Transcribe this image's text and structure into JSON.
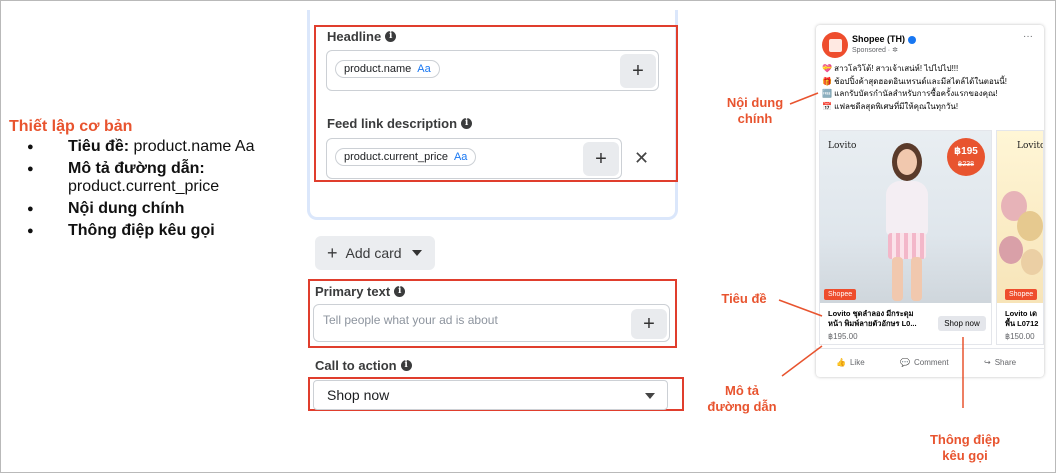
{
  "summary": {
    "title": "Thiết lập cơ bản",
    "items": [
      {
        "bold": "Tiêu đề:",
        "text": " product.name Aa"
      },
      {
        "bold": "Mô tả đường dẫn:",
        "text": "product.current_price"
      },
      {
        "bold": "Nội dung chính",
        "text": ""
      },
      {
        "bold": "Thông điệp kêu gọi",
        "text": ""
      }
    ]
  },
  "form": {
    "headline_label": "Headline",
    "headline_chip": "product.name",
    "headline_chip_aa": "Aa",
    "feed_label": "Feed link description",
    "feed_chip": "product.current_price",
    "feed_chip_aa": "Aa",
    "add_card_label": "Add card",
    "primary_text_label": "Primary text",
    "primary_text_placeholder": "Tell people what your ad is about",
    "cta_label": "Call to action",
    "cta_value": "Shop now",
    "plus": "+",
    "close": "✕",
    "info": "i"
  },
  "ad": {
    "page_name": "Shopee (TH)",
    "sponsored": "Sponsored · ✲",
    "menu": "···",
    "body_lines": [
      "💝 สาวโลวิโต้! สาวเจ้าเสน่ห์! ไปไปไป!!!",
      "🎁 ช้อปปิ้งค้าสุดฮอตอินเทรนด์และมีสไตล์ได้ในตอนนี้!",
      "🆓 แลกรับบัตรกำนัลสำหรับการซื้อครั้งแรกของคุณ!",
      "📅 แฟลชดีลสุดพิเศษที่มีให้คุณในทุกวัน!"
    ],
    "card1": {
      "brand": "Lovito",
      "badge_price": "฿195",
      "badge_old": "฿238",
      "tag": "Shopee",
      "title_line1": "Lovito ชุดลำลอง มีกระดุม",
      "title_line2": "หน้า พิมพ์ลายตัวอักษร L0...",
      "price": "฿195.00",
      "cta": "Shop now"
    },
    "card2": {
      "brand": "Lovito",
      "tag": "Shopee",
      "title_line1": "Lovito เด",
      "title_line2": "พื้น L0712",
      "price": "฿150.00"
    },
    "actions": {
      "like": "Like",
      "comment": "Comment",
      "share": "Share"
    }
  },
  "callouts": {
    "main_content": [
      "Nội dung",
      "chính"
    ],
    "headline": "Tiêu đề",
    "link_desc": [
      "Mô tả",
      "đường dẫn"
    ],
    "cta": [
      "Thông điệp",
      "kêu gọi"
    ]
  },
  "colors": {
    "accent": "#e8542f",
    "box": "#e03e2d",
    "shopee": "#ee4d2d",
    "fb_blue": "#1877f2"
  }
}
